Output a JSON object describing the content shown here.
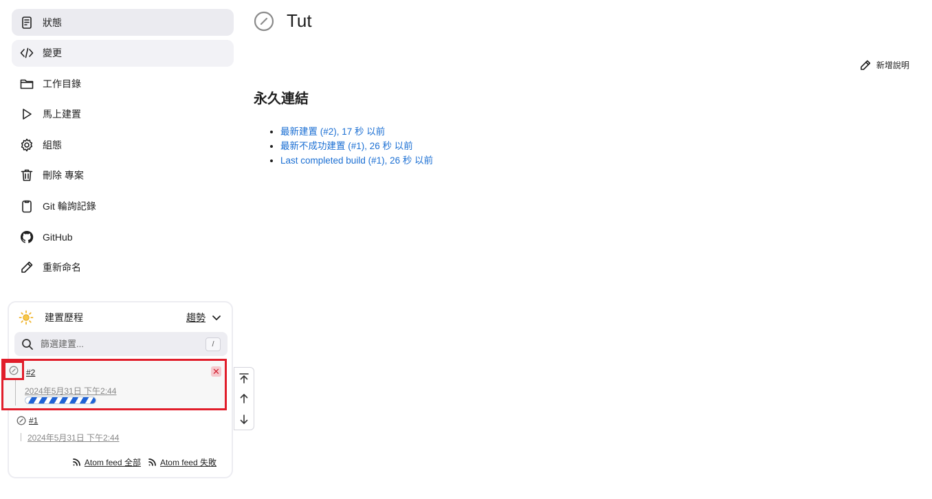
{
  "sidebar": {
    "items": [
      {
        "label": "狀態",
        "icon": "document-icon"
      },
      {
        "label": "變更",
        "icon": "code-icon"
      },
      {
        "label": "工作目錄",
        "icon": "folder-icon"
      },
      {
        "label": "馬上建置",
        "icon": "play-icon"
      },
      {
        "label": "組態",
        "icon": "gear-icon"
      },
      {
        "label": "刪除 專案",
        "icon": "trash-icon"
      },
      {
        "label": "Git 輪詢記錄",
        "icon": "clipboard-icon"
      },
      {
        "label": "GitHub",
        "icon": "github-icon"
      },
      {
        "label": "重新命名",
        "icon": "pencil-icon"
      }
    ]
  },
  "history": {
    "title": "建置歷程",
    "trend_label": "趨勢",
    "search_placeholder": "篩選建置...",
    "search_shortcut": "/",
    "builds": [
      {
        "number": "#2",
        "date": "2024年5月31日 下午2:44",
        "in_progress": true,
        "cancel": "✕"
      },
      {
        "number": "#1",
        "date": "2024年5月31日 下午2:44",
        "in_progress": false
      }
    ],
    "feeds": {
      "all": "Atom feed 全部",
      "failed": "Atom feed 失敗"
    }
  },
  "main": {
    "title": "Tut",
    "add_description": "新增說明",
    "permalinks_title": "永久連結",
    "permalinks": [
      "最新建置 (#2), 17 秒 以前",
      "最新不成功建置 (#1), 26 秒 以前",
      "Last completed build (#1), 26 秒 以前"
    ]
  },
  "colors": {
    "link": "#1b6fd3",
    "highlight_border": "#e11d2a",
    "progress": "#1f63d6"
  }
}
